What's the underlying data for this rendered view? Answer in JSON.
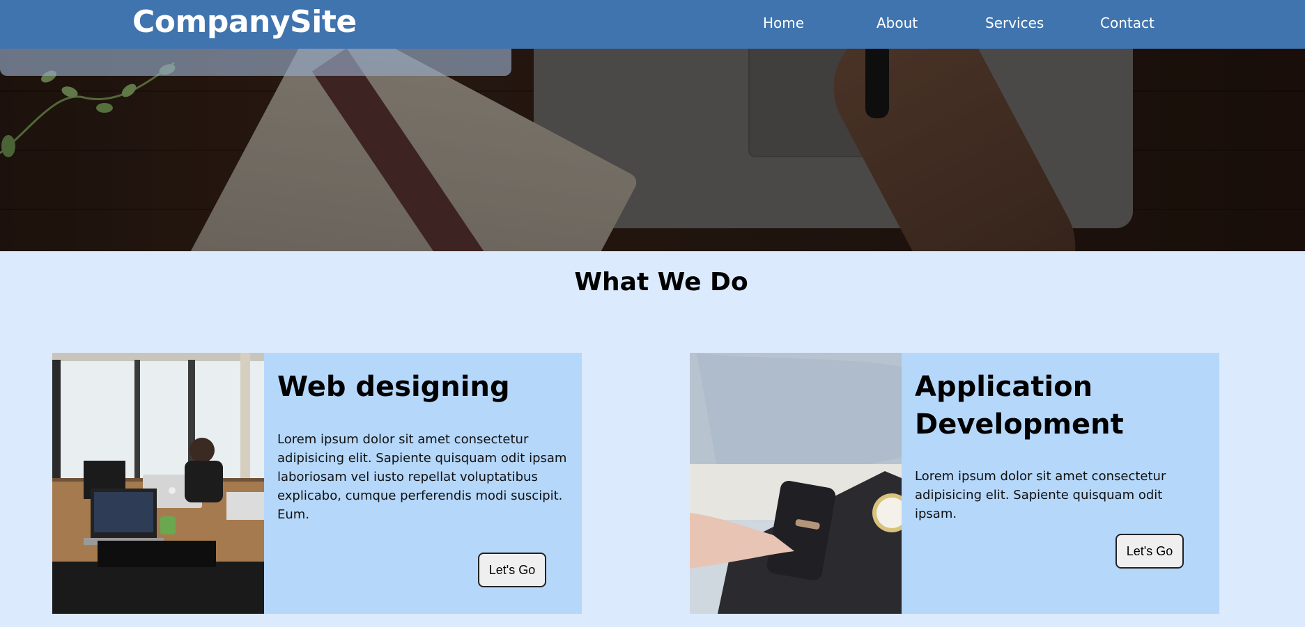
{
  "brand": "CompanySite",
  "nav": {
    "items": [
      {
        "label": "Home"
      },
      {
        "label": "About"
      },
      {
        "label": "Services"
      },
      {
        "label": "Contact"
      }
    ]
  },
  "main": {
    "section_title": "What We Do",
    "cards": [
      {
        "title": "Web designing",
        "text": "Lorem ipsum dolor sit amet consectetur adipisicing elit. Sapiente quisquam odit ipsam laboriosam vel iusto repellat voluptatibus explicabo, cumque perferendis modi suscipit. Eum.",
        "button": "Let's Go"
      },
      {
        "title": "Application Development",
        "text": "Lorem ipsum dolor sit amet consectetur adipisicing elit. Sapiente quisquam odit ipsam.",
        "button": "Let's Go"
      }
    ]
  },
  "colors": {
    "nav_bg": "#4074ae",
    "page_bg": "#dbeafc",
    "card_bg": "#b5d7fa"
  }
}
